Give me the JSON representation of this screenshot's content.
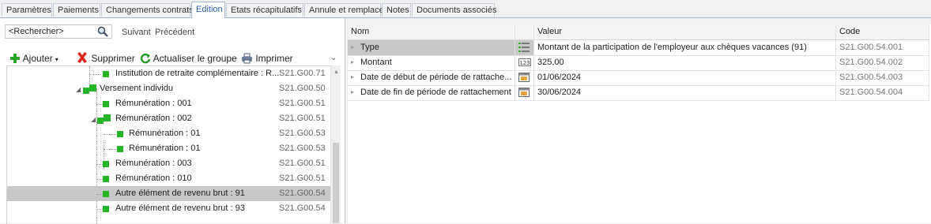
{
  "tabs": [
    "Paramètres",
    "Paiements",
    "Changements contrats",
    "Edition",
    "Etats récapitulatifs",
    "Annule et remplace",
    "Notes",
    "Documents associés"
  ],
  "active_tab": "Edition",
  "search": {
    "value": "<Rechercher>",
    "next": "Suivant",
    "prev": "Précédent"
  },
  "toolbar": {
    "add": "Ajouter",
    "delete": "Supprimer",
    "refresh": "Actualiser le groupe",
    "print": "Imprimer"
  },
  "tree": [
    {
      "label": "Institution de retraite complémentaire : R...",
      "code": "S21.G00.71"
    },
    {
      "label": "Versement individu",
      "code": "S21.G00.50"
    },
    {
      "label": "Rémunération : 001",
      "code": "S21.G00.51"
    },
    {
      "label": "Rémunération : 002",
      "code": "S21.G00.51"
    },
    {
      "label": "Rémunération : 01",
      "code": "S21.G00.53"
    },
    {
      "label": "Rémunération : 01",
      "code": "S21.G00.53"
    },
    {
      "label": "Rémunération : 003",
      "code": "S21.G00.51"
    },
    {
      "label": "Rémunération : 010",
      "code": "S21.G00.51"
    },
    {
      "label": "Autre élément de revenu brut : 91",
      "code": "S21.G00.54"
    },
    {
      "label": "Autre élément de revenu brut : 93",
      "code": "S21.G00.54"
    }
  ],
  "grid": {
    "headers": {
      "nom": "Nom",
      "valeur": "Valeur",
      "code": "Code"
    },
    "rows": [
      {
        "nom": "Type",
        "valeur": "Montant de la participation de l'employeur aux chèques vacances (91)",
        "code": "S21.G00.54.001",
        "icon": "list-icon"
      },
      {
        "nom": "Montant",
        "valeur": "325,00",
        "code": "S21.G00.54.002",
        "icon": "number-icon"
      },
      {
        "nom": "Date de début de période de rattache...",
        "valeur": "01/06/2024",
        "code": "S21.G00.54.003",
        "icon": "calendar-icon"
      },
      {
        "nom": "Date de fin de période de rattachement",
        "valeur": "30/06/2024",
        "code": "S21.G00.54.004",
        "icon": "calendar-icon"
      }
    ]
  },
  "colors": {
    "accent": "#2a5db0",
    "green": "#26b526",
    "selection": "#c8c8c8"
  }
}
